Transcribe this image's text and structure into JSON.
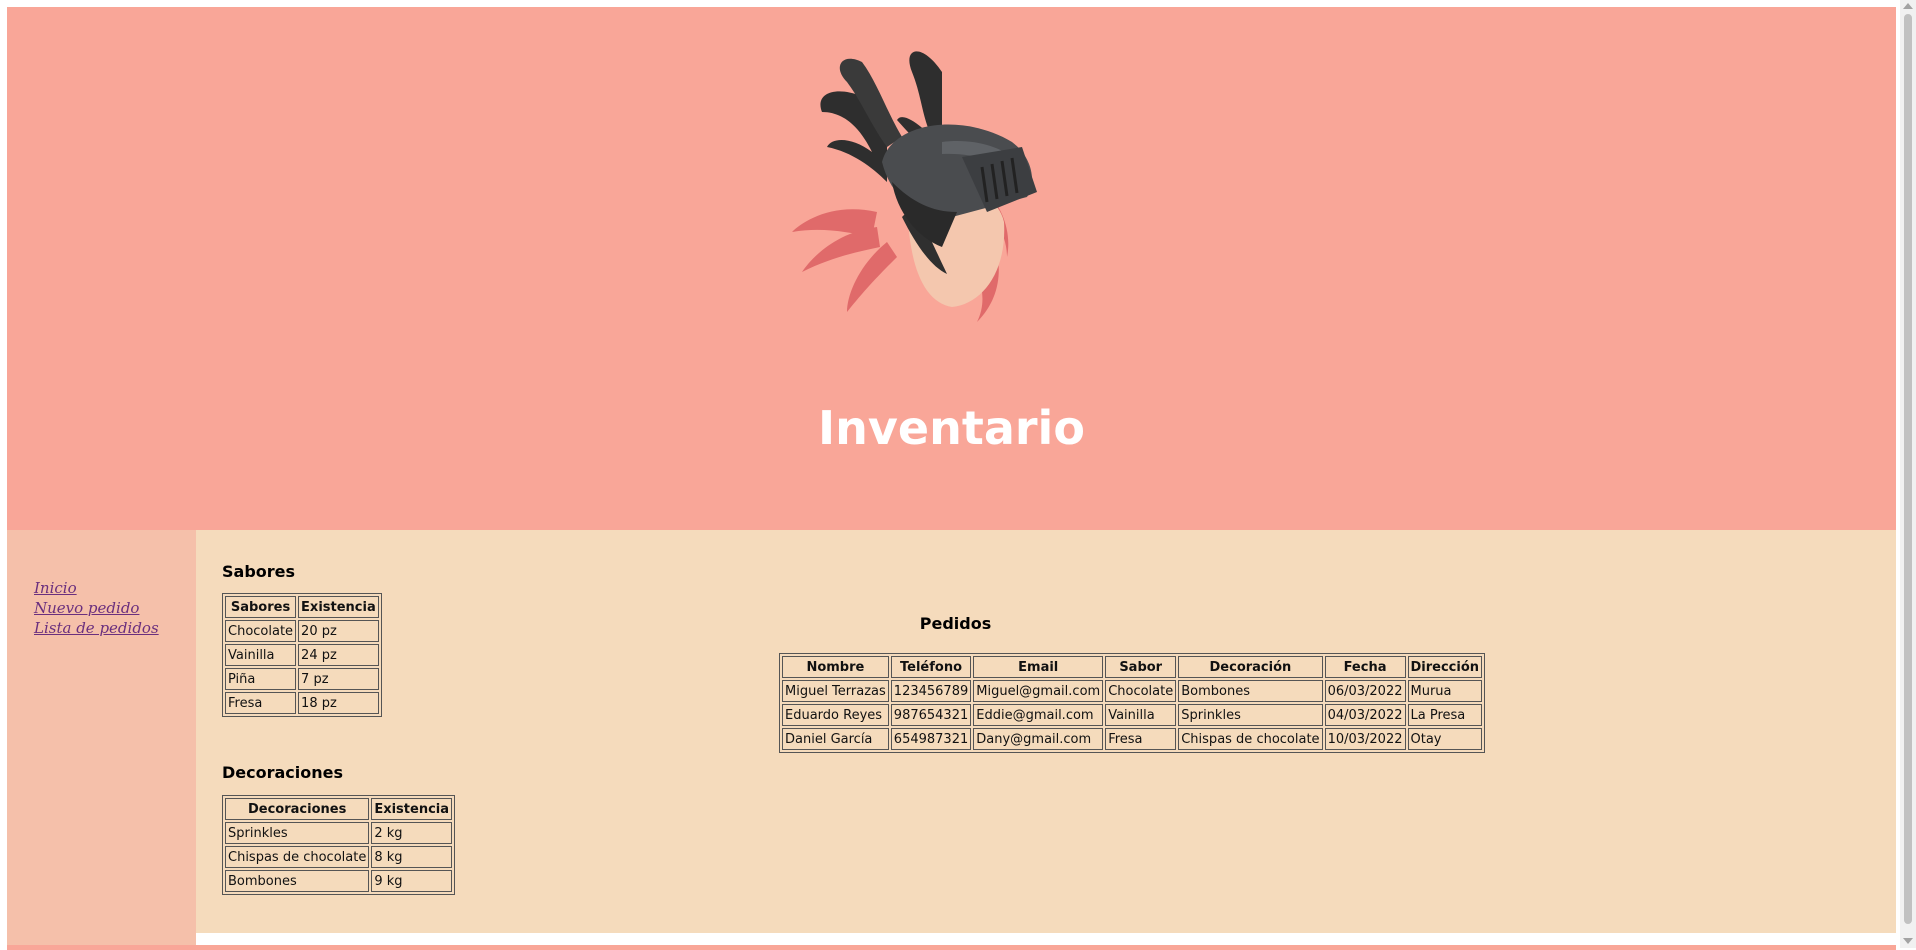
{
  "header": {
    "title": "Inventario",
    "logo_icon": "winged-helmet-logo"
  },
  "sidebar": {
    "links": [
      {
        "label": "Inicio"
      },
      {
        "label": "Nuevo pedido"
      },
      {
        "label": "Lista de pedidos"
      }
    ]
  },
  "sabores": {
    "heading": "Sabores",
    "columns": [
      "Sabores",
      "Existencia"
    ],
    "rows": [
      [
        "Chocolate",
        "20 pz"
      ],
      [
        "Vainilla",
        "24 pz"
      ],
      [
        "Piña",
        "7 pz"
      ],
      [
        "Fresa",
        "18 pz"
      ]
    ]
  },
  "decoraciones": {
    "heading": "Decoraciones",
    "columns": [
      "Decoraciones",
      "Existencia"
    ],
    "rows": [
      [
        "Sprinkles",
        "2 kg"
      ],
      [
        "Chispas de chocolate",
        "8 kg"
      ],
      [
        "Bombones",
        "9 kg"
      ]
    ]
  },
  "pedidos": {
    "heading": "Pedidos",
    "columns": [
      "Nombre",
      "Teléfono",
      "Email",
      "Sabor",
      "Decoración",
      "Fecha",
      "Dirección"
    ],
    "rows": [
      [
        "Miguel Terrazas",
        "123456789",
        "Miguel@gmail.com",
        "Chocolate",
        "Bombones",
        "06/03/2022",
        "Murua"
      ],
      [
        "Eduardo Reyes",
        "987654321",
        "Eddie@gmail.com",
        "Vainilla",
        "Sprinkles",
        "04/03/2022",
        "La Presa"
      ],
      [
        "Daniel García",
        "654987321",
        "Dany@gmail.com",
        "Fresa",
        "Chispas de chocolate",
        "10/03/2022",
        "Otay"
      ]
    ]
  },
  "colors": {
    "header_bg": "#f9a698",
    "sidebar_bg": "#f5c0aa",
    "main_bg": "#f5dbbc",
    "link": "#6a2f7e"
  }
}
